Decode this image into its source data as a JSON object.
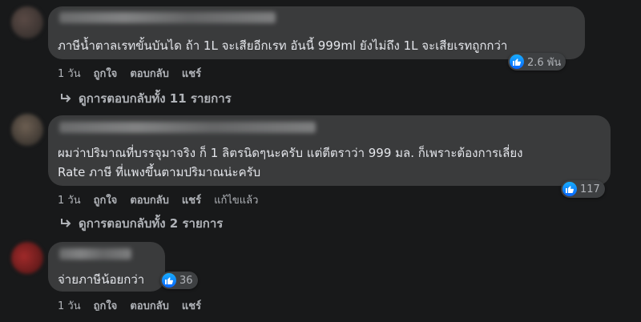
{
  "comments": [
    {
      "text_lines": [
        "ภาษีน้ำตาลเรทขั้นบันได ถ้า 1L จะเสียอีกเรท อันนี้ 999ml ยังไม่ถึง 1L จะเสียเรทถูกกว่า"
      ],
      "reaction_count": "2.6 พัน",
      "actions": {
        "time": "1 วัน",
        "like": "ถูกใจ",
        "reply": "ตอบกลับ",
        "share": "แชร์"
      },
      "view_replies": "ดูการตอบกลับทั้ง 11 รายการ"
    },
    {
      "text_lines": [
        "ผมว่าปริมาณที่บรรจุมาจริง ก็ 1 ลิตรนิดๆนะครับ แต่ตีตราว่า 999 มล. ก็เพราะต้องการเลี่ยง",
        "Rate ภาษี ที่แพงขึ้นตามปริมาณน่ะครับ"
      ],
      "reaction_count": "117",
      "actions": {
        "time": "1 วัน",
        "like": "ถูกใจ",
        "reply": "ตอบกลับ",
        "share": "แชร์",
        "edited": "แก้ไขแล้ว"
      },
      "view_replies": "ดูการตอบกลับทั้ง 2 รายการ"
    },
    {
      "text_lines": [
        "จ่ายภาษีน้อยกว่า"
      ],
      "reaction_count": "36",
      "actions": {
        "time": "1 วัน",
        "like": "ถูกใจ",
        "reply": "ตอบกลับ",
        "share": "แชร์"
      }
    }
  ],
  "icons": {
    "reaction": "like-icon",
    "reply_arrow": "reply-arrow-icon"
  },
  "colors": {
    "background": "#18191a",
    "bubble": "#3a3b3c",
    "like_blue": "#0866ff",
    "secondary_text": "#b0b3b8"
  }
}
